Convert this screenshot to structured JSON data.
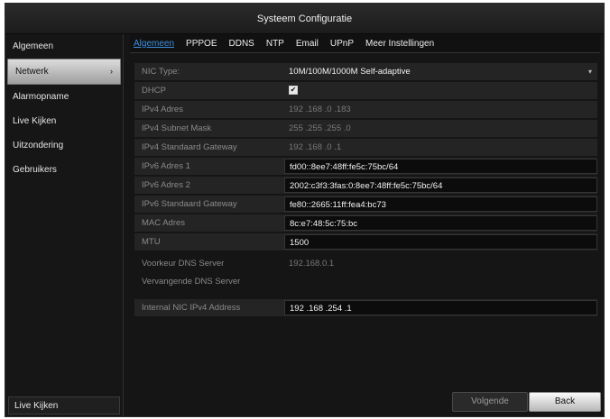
{
  "window": {
    "title": "Systeem Configuratie"
  },
  "sidebar": {
    "items": [
      {
        "label": "Algemeen",
        "active": false
      },
      {
        "label": "Netwerk",
        "active": true
      },
      {
        "label": "Alarmopname",
        "active": false
      },
      {
        "label": "Live Kijken",
        "active": false
      },
      {
        "label": "Uitzondering",
        "active": false
      },
      {
        "label": "Gebruikers",
        "active": false
      }
    ],
    "bottom_label": "Live Kijken"
  },
  "tabs": [
    {
      "label": "Algemeen",
      "active": true
    },
    {
      "label": "PPPOE",
      "active": false
    },
    {
      "label": "DDNS",
      "active": false
    },
    {
      "label": "NTP",
      "active": false
    },
    {
      "label": "Email",
      "active": false
    },
    {
      "label": "UPnP",
      "active": false
    },
    {
      "label": "Meer Instellingen",
      "active": false
    }
  ],
  "fields": {
    "nic_type": {
      "label": "NIC Type:",
      "value": "10M/100M/1000M Self-adaptive"
    },
    "dhcp": {
      "label": "DHCP",
      "checked": true,
      "mark": "✔"
    },
    "ipv4_address": {
      "label": "IPv4 Adres",
      "value": "192 .168 .0 .183"
    },
    "ipv4_subnet": {
      "label": "IPv4 Subnet Mask",
      "value": "255 .255 .255 .0"
    },
    "ipv4_gateway": {
      "label": "IPv4 Standaard Gateway",
      "value": "192 .168 .0 .1"
    },
    "ipv6_address_1": {
      "label": "IPv6 Adres 1",
      "value": "fd00::8ee7:48ff:fe5c:75bc/64"
    },
    "ipv6_address_2": {
      "label": "IPv6 Adres 2",
      "value": "2002:c3f3:3fas:0:8ee7:48ff:fe5c:75bc/64"
    },
    "ipv6_gateway": {
      "label": "IPv6 Standaard Gateway",
      "value": "fe80::2665:11ff:fea4:bc73"
    },
    "mac_address": {
      "label": "MAC Adres",
      "value": "8c:e7:48:5c:75:bc"
    },
    "mtu": {
      "label": "MTU",
      "value": "1500"
    },
    "preferred_dns": {
      "label": "Voorkeur DNS Server",
      "value": "192.168.0.1"
    },
    "alternate_dns": {
      "label": "Vervangende DNS Server",
      "value": ""
    },
    "internal_nic": {
      "label": "Internal NIC IPv4 Address",
      "value": "192 .168 .254 .1"
    }
  },
  "buttons": {
    "next": "Volgende",
    "back": "Back"
  },
  "icons": {
    "sidebar_chevron": "chevron-right-icon",
    "dropdown": "chevron-down-icon"
  }
}
